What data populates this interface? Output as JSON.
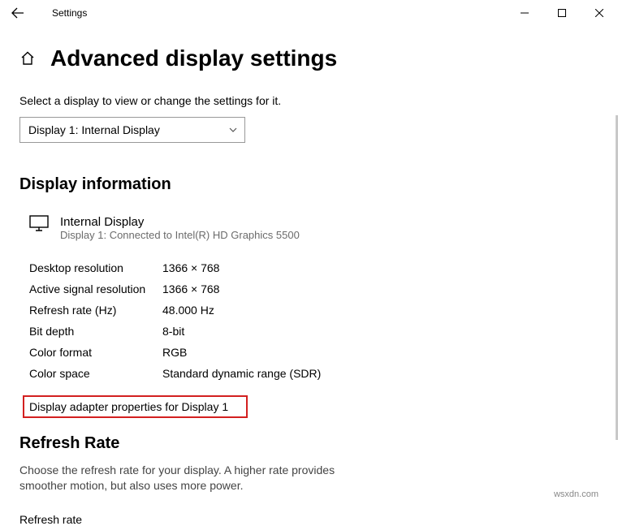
{
  "window": {
    "title": "Settings"
  },
  "page": {
    "title": "Advanced display settings",
    "instruction": "Select a display to view or change the settings for it."
  },
  "dropdown": {
    "selected": "Display 1: Internal Display"
  },
  "sections": {
    "info_heading": "Display information",
    "refresh_heading": "Refresh Rate"
  },
  "display": {
    "name": "Internal Display",
    "sub": "Display 1: Connected to Intel(R) HD Graphics 5500"
  },
  "info": {
    "desktop_res": {
      "label": "Desktop resolution",
      "value": "1366 × 768"
    },
    "active_res": {
      "label": "Active signal resolution",
      "value": "1366 × 768"
    },
    "refresh": {
      "label": "Refresh rate (Hz)",
      "value": "48.000 Hz"
    },
    "bit_depth": {
      "label": "Bit depth",
      "value": "8-bit"
    },
    "color_fmt": {
      "label": "Color format",
      "value": "RGB"
    },
    "color_space": {
      "label": "Color space",
      "value": "Standard dynamic range (SDR)"
    }
  },
  "adapter_link": "Display adapter properties for Display 1",
  "refresh_section": {
    "desc": "Choose the refresh rate for your display. A higher rate provides smoother motion, but also uses more power.",
    "label": "Refresh rate"
  },
  "watermark": "wsxdn.com"
}
